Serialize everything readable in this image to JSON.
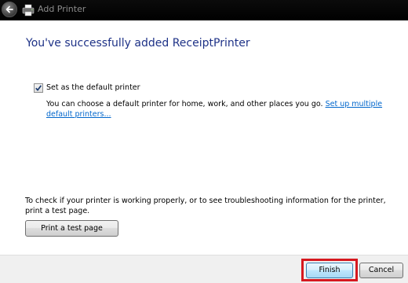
{
  "window": {
    "title": "Add Printer"
  },
  "main": {
    "heading": "You've successfully added ReceiptPrinter",
    "default_checkbox": {
      "label": "Set as the default printer",
      "checked": true
    },
    "description": "You can choose a default printer for home, work, and other places you go.",
    "description_link": "Set up multiple default printers...",
    "test_info": "To check if your printer is working properly, or to see troubleshooting information for the printer, print a test page.",
    "test_button": "Print a test page"
  },
  "footer": {
    "finish_label": "Finish",
    "cancel_label": "Cancel"
  },
  "colors": {
    "heading": "#1e3287",
    "link": "#0066cc",
    "highlight": "#d6181f",
    "titlebar": "#000000"
  },
  "icons": [
    "back-arrow-icon",
    "printer-icon",
    "checkmark-icon"
  ]
}
